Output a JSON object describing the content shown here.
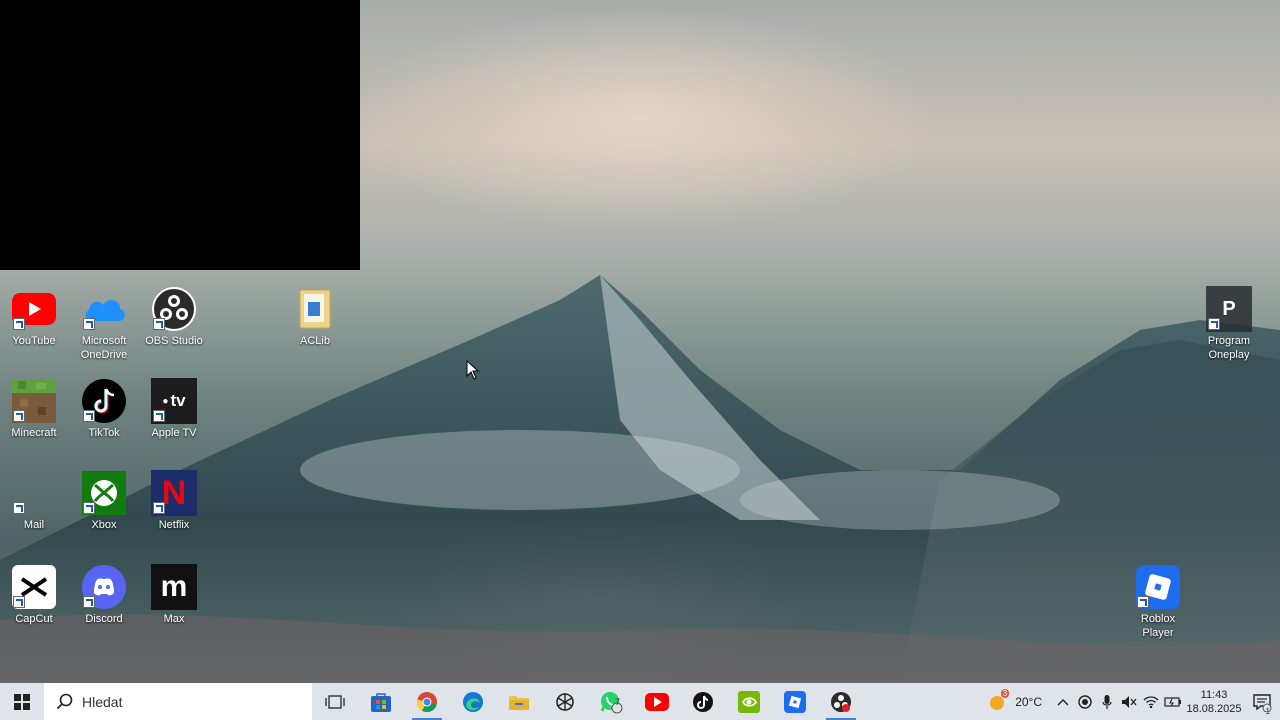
{
  "desktop": {
    "icons": [
      {
        "id": "youtube",
        "label": "YouTube"
      },
      {
        "id": "onedrive",
        "label": "Microsoft OneDrive"
      },
      {
        "id": "obs",
        "label": "OBS Studio"
      },
      {
        "id": "aclib",
        "label": "ACLib"
      },
      {
        "id": "minecraft",
        "label": "Minecraft"
      },
      {
        "id": "tiktok",
        "label": "TikTok"
      },
      {
        "id": "appletv",
        "label": "Apple TV"
      },
      {
        "id": "mail",
        "label": "Mail"
      },
      {
        "id": "xbox",
        "label": "Xbox"
      },
      {
        "id": "netflix",
        "label": "Netflix"
      },
      {
        "id": "capcut",
        "label": "CapCut"
      },
      {
        "id": "discord",
        "label": "Discord"
      },
      {
        "id": "max",
        "label": "Max"
      },
      {
        "id": "oneplay",
        "label": "Program Oneplay",
        "glyph": "P"
      },
      {
        "id": "roblox",
        "label": "Roblox Player"
      }
    ],
    "tile_text": {
      "appletv": "tv",
      "netflix": "N",
      "max": "m"
    }
  },
  "taskbar": {
    "search_placeholder": "Hledat",
    "apps": [
      {
        "id": "task-view",
        "icon": "task-view-icon"
      },
      {
        "id": "store",
        "icon": "microsoft-store-icon"
      },
      {
        "id": "chrome",
        "icon": "chrome-icon",
        "active": true
      },
      {
        "id": "edge",
        "icon": "edge-icon"
      },
      {
        "id": "explorer",
        "icon": "file-explorer-icon"
      },
      {
        "id": "chatgpt",
        "icon": "chatgpt-icon"
      },
      {
        "id": "whatsapp",
        "icon": "whatsapp-icon",
        "badge": "7"
      },
      {
        "id": "youtube",
        "icon": "youtube-icon"
      },
      {
        "id": "tiktok",
        "icon": "tiktok-icon"
      },
      {
        "id": "nvidia",
        "icon": "nvidia-icon"
      },
      {
        "id": "roblox",
        "icon": "roblox-icon"
      },
      {
        "id": "obs",
        "icon": "obs-icon",
        "active": true
      }
    ],
    "weather": {
      "temp": "20°C",
      "badge": "3"
    },
    "clock": {
      "time": "11:43",
      "date": "18.08.2025"
    },
    "notification_count": "1"
  },
  "colors": {
    "taskbar_bg": "#dfe3ea",
    "youtube_red": "#ff0000",
    "xbox_green": "#107c10",
    "netflix_red": "#e50914",
    "discord_blurple": "#5865f2",
    "roblox_blue": "#1e6cf0"
  }
}
